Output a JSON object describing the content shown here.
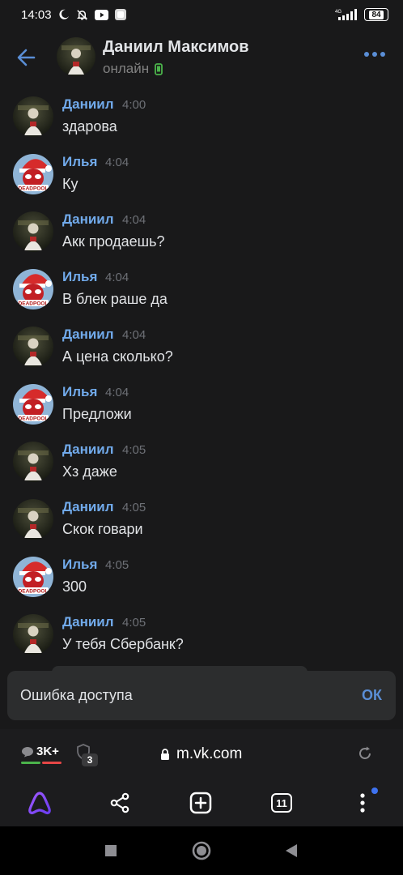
{
  "status_bar": {
    "time": "14:03",
    "network": "4G",
    "battery": "84",
    "icons": [
      "moon-icon",
      "bell-off-icon",
      "youtube-icon",
      "app-icon",
      "signal-icon",
      "battery-icon"
    ]
  },
  "header": {
    "name": "Даниил Максимов",
    "status": "онлайн",
    "icons": [
      "back-arrow-icon",
      "mobile-online-icon",
      "more-icon"
    ]
  },
  "messages": [
    {
      "author": "Даниил",
      "time": "4:00",
      "text": "здарова"
    },
    {
      "author": "Илья",
      "time": "4:04",
      "text": "Ку"
    },
    {
      "author": "Даниил",
      "time": "4:04",
      "text": "Акк продаешь?"
    },
    {
      "author": "Илья",
      "time": "4:04",
      "text": "В блек раше да"
    },
    {
      "author": "Даниил",
      "time": "4:04",
      "text": "А цена сколько?"
    },
    {
      "author": "Илья",
      "time": "4:04",
      "text": "Предложи"
    },
    {
      "author": "Даниил",
      "time": "4:05",
      "text": "Хз даже"
    },
    {
      "author": "Даниил",
      "time": "4:05",
      "text": "Скок говари"
    },
    {
      "author": "Илья",
      "time": "4:05",
      "text": "300"
    },
    {
      "author": "Даниил",
      "time": "4:05",
      "text": "У тебя Сбербанк?"
    }
  ],
  "snackbar": {
    "text": "Ошибка доступа",
    "action": "ОК"
  },
  "browser": {
    "bubble_count": "3K+",
    "tracker_count": "3",
    "url": "m.vk.com",
    "tab_count": "11"
  },
  "colors": {
    "background": "#19191a",
    "author": "#71aaeb",
    "accent": "#5a8ed6",
    "snackbar": "#2c2d2e"
  }
}
